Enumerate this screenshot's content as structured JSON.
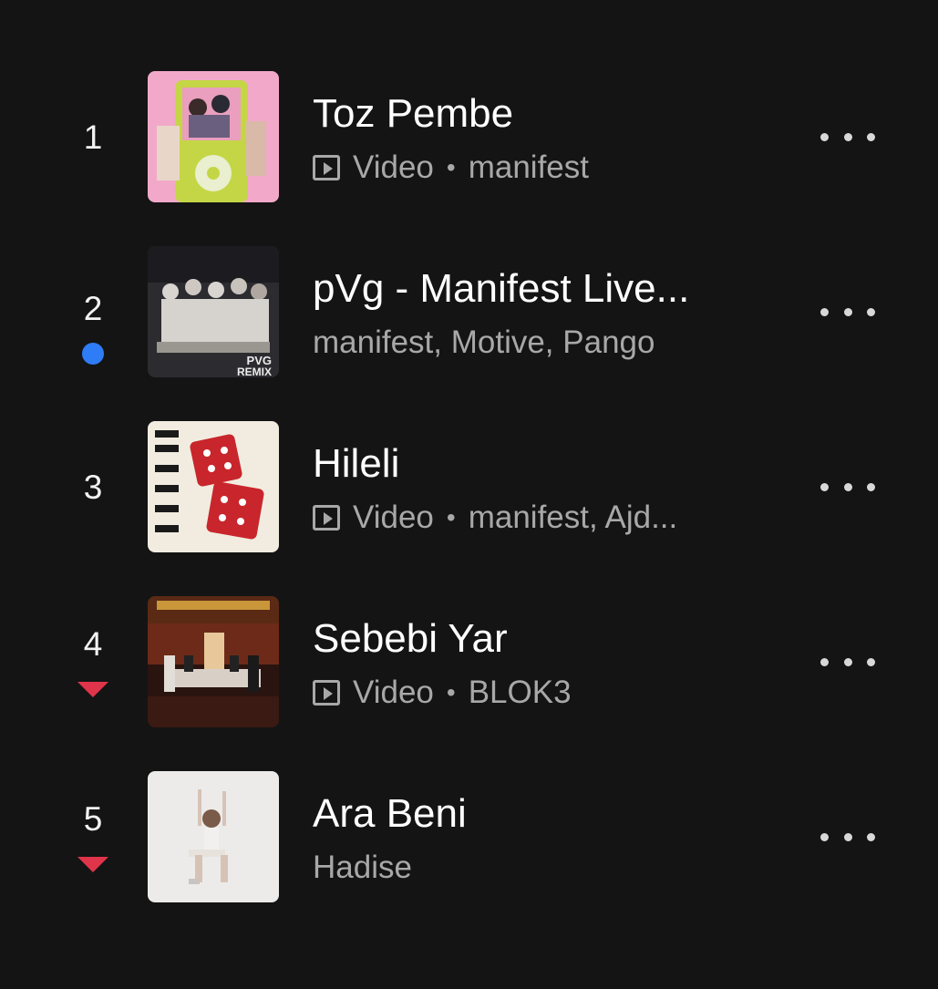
{
  "tracks": [
    {
      "rank": "1",
      "title": "Toz Pembe",
      "video_label": "Video",
      "separator": "•",
      "artists": "manifest",
      "change": "none",
      "art_icon": "album-art-toz-pembe"
    },
    {
      "rank": "2",
      "title": "pVg - Manifest Live...",
      "video_label": "",
      "separator": "",
      "artists": "manifest, Motive, Pango",
      "change": "new",
      "art_icon": "album-art-pvg"
    },
    {
      "rank": "3",
      "title": "Hileli",
      "video_label": "Video",
      "separator": "•",
      "artists": "manifest, Ajd...",
      "change": "none",
      "art_icon": "album-art-hileli"
    },
    {
      "rank": "4",
      "title": "Sebebi Yar",
      "video_label": "Video",
      "separator": "•",
      "artists": "BLOK3",
      "change": "down",
      "art_icon": "album-art-sebebi-yar"
    },
    {
      "rank": "5",
      "title": "Ara Beni",
      "video_label": "",
      "separator": "",
      "artists": "Hadise",
      "change": "down",
      "art_icon": "album-art-ara-beni"
    }
  ],
  "colors": {
    "background": "#141414",
    "new_dot": "#2e7cf6",
    "down_arrow": "#e0344a",
    "subtitle": "#a8a8a8"
  }
}
